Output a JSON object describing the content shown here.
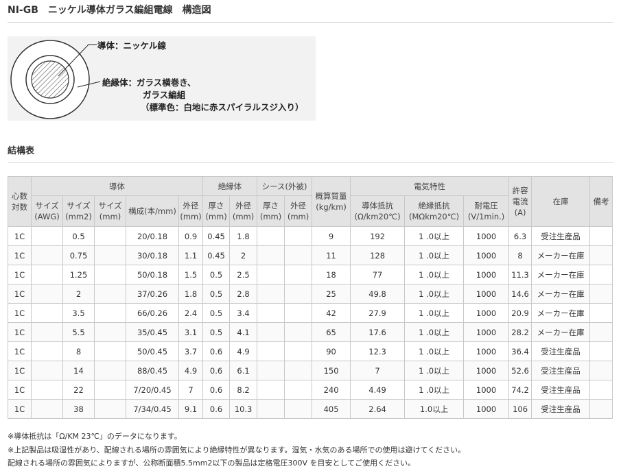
{
  "page_title": "NI-GB　ニッケル導体ガラス編組電線　構造図",
  "figure": {
    "conductor_label": "導体：ニッケル線",
    "insulator_line1": "絶縁体：ガラス横巻き、",
    "insulator_line2": "ガラス編組",
    "insulator_line3": "（標準色：白地に赤スパイラルスジ入り）"
  },
  "table_heading": "結構表",
  "table": {
    "groups": {
      "cores": "心数対数",
      "conductor": "導体",
      "insulator": "絶縁体",
      "sheath": "シース(外被)",
      "weight": "概算質量(kg/km)",
      "electrical": "電気特性",
      "current": "許容電流(A)",
      "stock": "在庫",
      "remarks": "備考"
    },
    "sub": {
      "awg": "サイズ(AWG)",
      "mm2": "サイズ(mm2)",
      "mm": "サイズ(mm)",
      "composition": "構成(本/mm)",
      "cond_od": "外径(mm)",
      "ins_thick": "厚さ(mm)",
      "ins_od": "外径(mm)",
      "sh_thick": "厚さ(mm)",
      "sh_od": "外径(mm)",
      "cond_res": "導体抵抗(Ω/km20℃)",
      "ins_res": "絶縁抵抗(MΩkm20℃)",
      "voltage": "耐電圧(V/1min.)"
    },
    "rows": [
      {
        "cores": "1C",
        "awg": "",
        "mm2": "0.5",
        "mm": "",
        "composition": "20/0.18",
        "cond_od": "0.9",
        "ins_thick": "0.45",
        "ins_od": "1.8",
        "sh_thick": "",
        "sh_od": "",
        "weight": "9",
        "cond_res": "192",
        "ins_res": "1 .0以上",
        "voltage": "1000",
        "current": "6.3",
        "stock": "受注生産品",
        "remarks": ""
      },
      {
        "cores": "1C",
        "awg": "",
        "mm2": "0.75",
        "mm": "",
        "composition": "30/0.18",
        "cond_od": "1.1",
        "ins_thick": "0.45",
        "ins_od": "2",
        "sh_thick": "",
        "sh_od": "",
        "weight": "11",
        "cond_res": "128",
        "ins_res": "1 .0以上",
        "voltage": "1000",
        "current": "8",
        "stock": "メーカー在庫",
        "remarks": ""
      },
      {
        "cores": "1C",
        "awg": "",
        "mm2": "1.25",
        "mm": "",
        "composition": "50/0.18",
        "cond_od": "1.5",
        "ins_thick": "0.5",
        "ins_od": "2.5",
        "sh_thick": "",
        "sh_od": "",
        "weight": "18",
        "cond_res": "77",
        "ins_res": "1 .0以上",
        "voltage": "1000",
        "current": "11.3",
        "stock": "メーカー在庫",
        "remarks": ""
      },
      {
        "cores": "1C",
        "awg": "",
        "mm2": "2",
        "mm": "",
        "composition": "37/0.26",
        "cond_od": "1.8",
        "ins_thick": "0.5",
        "ins_od": "2.8",
        "sh_thick": "",
        "sh_od": "",
        "weight": "25",
        "cond_res": "49.8",
        "ins_res": "1 .0以上",
        "voltage": "1000",
        "current": "14.6",
        "stock": "メーカー在庫",
        "remarks": ""
      },
      {
        "cores": "1C",
        "awg": "",
        "mm2": "3.5",
        "mm": "",
        "composition": "66/0.26",
        "cond_od": "2.4",
        "ins_thick": "0.5",
        "ins_od": "3.4",
        "sh_thick": "",
        "sh_od": "",
        "weight": "42",
        "cond_res": "27.9",
        "ins_res": "1 .0以上",
        "voltage": "1000",
        "current": "20.9",
        "stock": "メーカー在庫",
        "remarks": ""
      },
      {
        "cores": "1C",
        "awg": "",
        "mm2": "5.5",
        "mm": "",
        "composition": "35/0.45",
        "cond_od": "3.1",
        "ins_thick": "0.5",
        "ins_od": "4.1",
        "sh_thick": "",
        "sh_od": "",
        "weight": "65",
        "cond_res": "17.6",
        "ins_res": "1 .0以上",
        "voltage": "1000",
        "current": "28.2",
        "stock": "メーカー在庫",
        "remarks": ""
      },
      {
        "cores": "1C",
        "awg": "",
        "mm2": "8",
        "mm": "",
        "composition": "50/0.45",
        "cond_od": "3.7",
        "ins_thick": "0.6",
        "ins_od": "4.9",
        "sh_thick": "",
        "sh_od": "",
        "weight": "90",
        "cond_res": "12.3",
        "ins_res": "1 .0以上",
        "voltage": "1000",
        "current": "36.4",
        "stock": "受注生産品",
        "remarks": ""
      },
      {
        "cores": "1C",
        "awg": "",
        "mm2": "14",
        "mm": "",
        "composition": "88/0.45",
        "cond_od": "4.9",
        "ins_thick": "0.6",
        "ins_od": "6.1",
        "sh_thick": "",
        "sh_od": "",
        "weight": "150",
        "cond_res": "7",
        "ins_res": "1 .0以上",
        "voltage": "1000",
        "current": "52.6",
        "stock": "受注生産品",
        "remarks": ""
      },
      {
        "cores": "1C",
        "awg": "",
        "mm2": "22",
        "mm": "",
        "composition": "7/20/0.45",
        "cond_od": "7",
        "ins_thick": "0.6",
        "ins_od": "8.2",
        "sh_thick": "",
        "sh_od": "",
        "weight": "240",
        "cond_res": "4.49",
        "ins_res": "1 .0以上",
        "voltage": "1000",
        "current": "74.2",
        "stock": "受注生産品",
        "remarks": ""
      },
      {
        "cores": "1C",
        "awg": "",
        "mm2": "38",
        "mm": "",
        "composition": "7/34/0.45",
        "cond_od": "9.1",
        "ins_thick": "0.6",
        "ins_od": "10.3",
        "sh_thick": "",
        "sh_od": "",
        "weight": "405",
        "cond_res": "2.64",
        "ins_res": "1.0以上",
        "voltage": "1000",
        "current": "106",
        "stock": "受注生産品",
        "remarks": ""
      }
    ]
  },
  "notes": [
    "※導体抵抗は「Ω/KM 23℃」のデータになります。",
    "※上記製品は吸湿性があり、配線される場所の雰囲気により絶縁特性が異なります。湿気・水気のある場所での使用は避けてください。",
    "配線される場所の雰囲気によりますが、公称断面積5.5mm2以下の製品は定格電圧300V を目安としてご使用ください。"
  ]
}
